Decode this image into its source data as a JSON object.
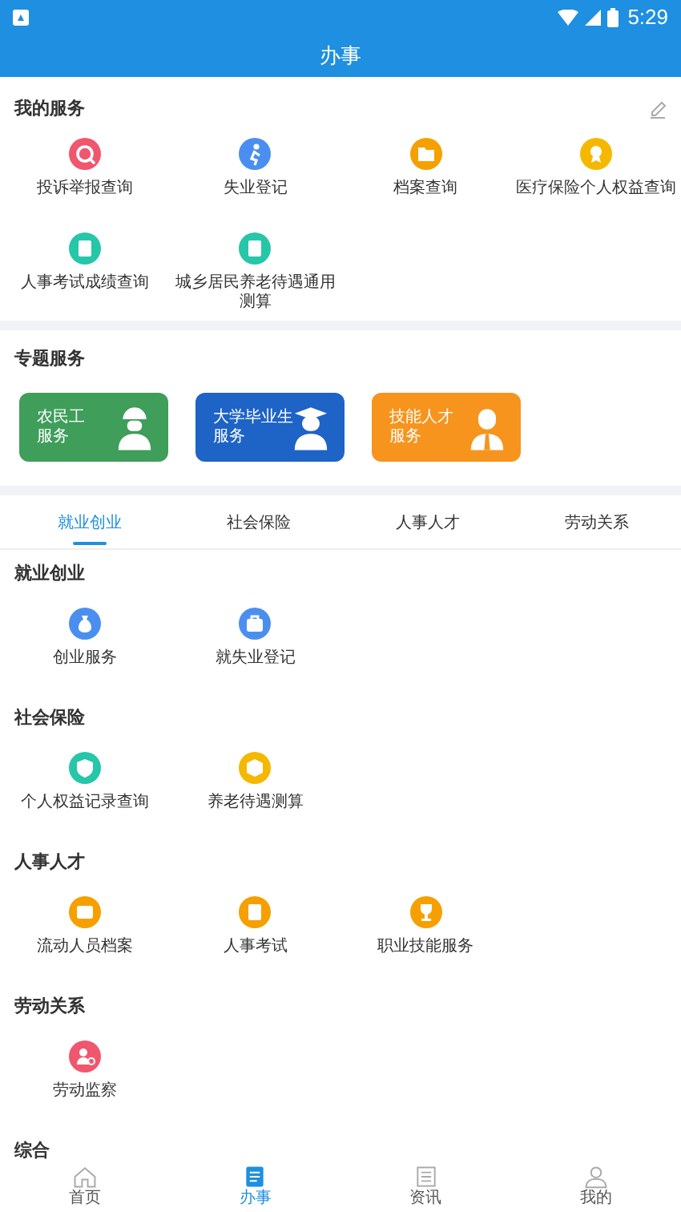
{
  "status_bar": {
    "time": "5:29"
  },
  "app_bar": {
    "title": "办事"
  },
  "my_services": {
    "title": "我的服务",
    "items": [
      {
        "label": "投诉举报查询",
        "color": "#f0566e",
        "kind": "search"
      },
      {
        "label": "失业登记",
        "color": "#4a8ff0",
        "kind": "runner"
      },
      {
        "label": "档案查询",
        "color": "#f5a000",
        "kind": "folder"
      },
      {
        "label": "医疗保险个人权益查询",
        "color": "#f5b800",
        "kind": "badge"
      },
      {
        "label": "人事考试成绩查询",
        "color": "#26c6a8",
        "kind": "doc"
      },
      {
        "label": "城乡居民养老待遇通用测算",
        "color": "#26c6a8",
        "kind": "doc"
      }
    ]
  },
  "featured": {
    "title": "专题服务",
    "cards": [
      {
        "lines": [
          "农民工",
          "服务"
        ],
        "color": "#3f9e5a",
        "kind": "worker"
      },
      {
        "lines": [
          "大学毕业生",
          "服务"
        ],
        "color": "#1e63c6",
        "kind": "graduate"
      },
      {
        "lines": [
          "技能人才",
          "服务"
        ],
        "color": "#f7941d",
        "kind": "suit"
      }
    ]
  },
  "tabs": [
    {
      "label": "就业创业",
      "selected": true
    },
    {
      "label": "社会保险",
      "selected": false
    },
    {
      "label": "人事人才",
      "selected": false
    },
    {
      "label": "劳动关系",
      "selected": false
    }
  ],
  "categories": [
    {
      "title": "就业创业",
      "items": [
        {
          "label": "创业服务",
          "color": "#4a8ff0",
          "kind": "bag"
        },
        {
          "label": "就失业登记",
          "color": "#4a8ff0",
          "kind": "briefcase"
        }
      ]
    },
    {
      "title": "社会保险",
      "items": [
        {
          "label": "个人权益记录查询",
          "color": "#26c6a8",
          "kind": "shield"
        },
        {
          "label": "养老待遇测算",
          "color": "#f5b800",
          "kind": "box"
        }
      ]
    },
    {
      "title": "人事人才",
      "items": [
        {
          "label": "流动人员档案",
          "color": "#f5a000",
          "kind": "card"
        },
        {
          "label": "人事考试",
          "color": "#f5a000",
          "kind": "doc"
        },
        {
          "label": "职业技能服务",
          "color": "#f5a000",
          "kind": "trophy"
        }
      ]
    },
    {
      "title": "劳动关系",
      "items": [
        {
          "label": "劳动监察",
          "color": "#f0566e",
          "kind": "person"
        }
      ]
    },
    {
      "title": "综合"
    }
  ],
  "bottom_nav": [
    {
      "label": "首页",
      "selected": false,
      "kind": "home"
    },
    {
      "label": "办事",
      "selected": true,
      "kind": "tasks"
    },
    {
      "label": "资讯",
      "selected": false,
      "kind": "news"
    },
    {
      "label": "我的",
      "selected": false,
      "kind": "user"
    }
  ]
}
